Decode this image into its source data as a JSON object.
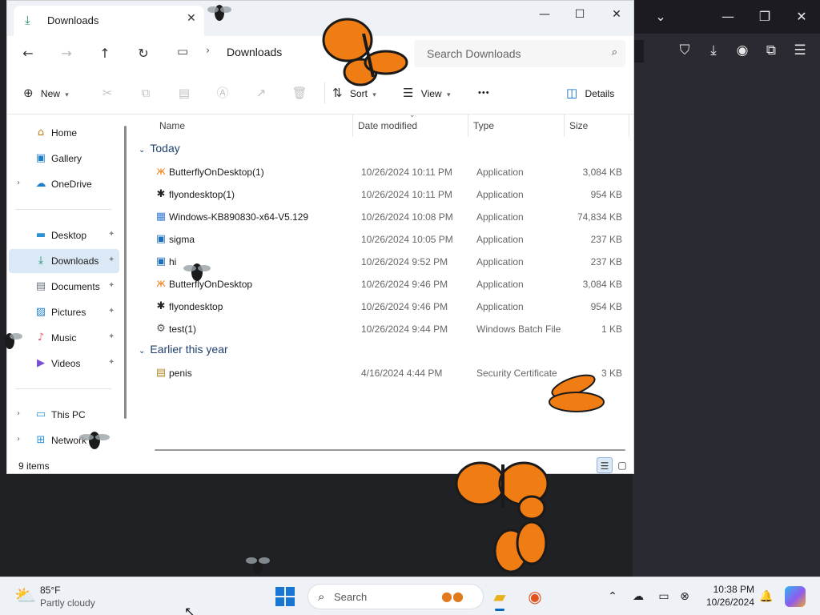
{
  "browser": {
    "controls": {
      "tabs_menu": "⌄",
      "minimize": "—",
      "restore": "❐",
      "close": "✕"
    },
    "toolbar_icons": [
      "pocket-icon",
      "download-icon",
      "account-icon",
      "extensions-icon",
      "menu-icon"
    ]
  },
  "explorer": {
    "tab": {
      "title": "Downloads"
    },
    "window_controls": {
      "minimize": "—",
      "maximize": "☐",
      "close": "✕"
    },
    "address": {
      "crumb": "Downloads"
    },
    "search": {
      "placeholder": "Search Downloads"
    },
    "commands": {
      "new": "New",
      "sort": "Sort",
      "view": "View",
      "more": "•••",
      "details": "Details"
    },
    "nav": {
      "items": [
        {
          "label": "Home",
          "icon": "home-icon"
        },
        {
          "label": "Gallery",
          "icon": "gallery-icon"
        },
        {
          "label": "OneDrive",
          "icon": "cloud-icon"
        },
        {
          "label": "Desktop",
          "icon": "desktop-icon"
        },
        {
          "label": "Downloads",
          "icon": "download-icon"
        },
        {
          "label": "Documents",
          "icon": "documents-icon"
        },
        {
          "label": "Pictures",
          "icon": "pictures-icon"
        },
        {
          "label": "Music",
          "icon": "music-icon"
        },
        {
          "label": "Videos",
          "icon": "videos-icon"
        },
        {
          "label": "This PC",
          "icon": "computer-icon"
        },
        {
          "label": "Network",
          "icon": "network-icon"
        }
      ]
    },
    "columns": {
      "name": "Name",
      "date": "Date modified",
      "type": "Type",
      "size": "Size"
    },
    "groups": [
      {
        "label": "Today",
        "files": [
          {
            "name": "ButterflyOnDesktop(1)",
            "date": "10/26/2024 10:11 PM",
            "type": "Application",
            "size": "3,084 KB",
            "icon": "butterfly-app-icon"
          },
          {
            "name": "flyondesktop(1)",
            "date": "10/26/2024 10:11 PM",
            "type": "Application",
            "size": "954 KB",
            "icon": "fly-app-icon"
          },
          {
            "name": "Windows-KB890830-x64-V5.129",
            "date": "10/26/2024 10:08 PM",
            "type": "Application",
            "size": "74,834 KB",
            "icon": "installer-icon"
          },
          {
            "name": "sigma",
            "date": "10/26/2024 10:05 PM",
            "type": "Application",
            "size": "237 KB",
            "icon": "app-window-icon"
          },
          {
            "name": "hi",
            "date": "10/26/2024 9:52 PM",
            "type": "Application",
            "size": "237 KB",
            "icon": "app-window-icon"
          },
          {
            "name": "ButterflyOnDesktop",
            "date": "10/26/2024 9:46 PM",
            "type": "Application",
            "size": "3,084 KB",
            "icon": "butterfly-app-icon"
          },
          {
            "name": "flyondesktop",
            "date": "10/26/2024 9:46 PM",
            "type": "Application",
            "size": "954 KB",
            "icon": "fly-app-icon"
          },
          {
            "name": "test(1)",
            "date": "10/26/2024 9:44 PM",
            "type": "Windows Batch File",
            "size": "1 KB",
            "icon": "batch-file-icon"
          }
        ]
      },
      {
        "label": "Earlier this year",
        "files": [
          {
            "name": "penis",
            "date": "4/16/2024 4:44 PM",
            "type": "Security Certificate",
            "size": "3 KB",
            "icon": "certificate-icon"
          }
        ]
      }
    ],
    "status": {
      "count": "9 items"
    }
  },
  "taskbar": {
    "weather": {
      "temp": "85°F",
      "desc": "Partly cloudy"
    },
    "search": {
      "placeholder": "Search"
    },
    "clock": {
      "time": "10:38 PM",
      "date": "10/26/2024"
    }
  },
  "colors": {
    "butterfly": "#f07c14",
    "accent": "#0067c0",
    "selection": "#dbe8f6"
  }
}
